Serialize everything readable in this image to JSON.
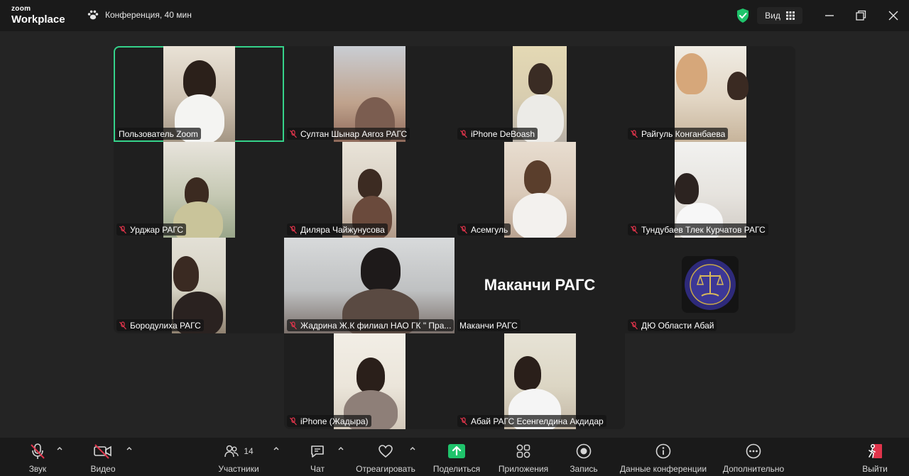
{
  "app": {
    "logo_top": "zoom",
    "logo_bottom": "Workplace",
    "meeting_title": "Конференция, 40 мин",
    "view_label": "Вид"
  },
  "participants": [
    {
      "name": "Пользователь Zoom",
      "muted": false,
      "active": true
    },
    {
      "name": "Султан Шынар Аягоз РАГС",
      "muted": true
    },
    {
      "name": "iPhone DeBoash",
      "muted": true
    },
    {
      "name": "Райгуль Конганбаева",
      "muted": true
    },
    {
      "name": "Урджар РАГС",
      "muted": true
    },
    {
      "name": "Диляра Чайжунусова",
      "muted": true
    },
    {
      "name": "Асемгуль",
      "muted": true
    },
    {
      "name": "Тундубаев Тлек Курчатов РАГС",
      "muted": true
    },
    {
      "name": "Бородулиха РАГС",
      "muted": true
    },
    {
      "name": "Жадрина Ж.К филиал НАО ГК \" Пра...",
      "muted": true
    },
    {
      "name": "Маканчи РАГС",
      "muted": false,
      "display_text": "Маканчи РАГС"
    },
    {
      "name": "ДЮ Области Абай",
      "muted": true
    },
    {
      "name": "iPhone (Жадыра)",
      "muted": true
    },
    {
      "name": "Абай РАГС Есенгелдина Акдидар",
      "muted": true
    }
  ],
  "toolbar": {
    "audio": "Звук",
    "video": "Видео",
    "participants": "Участники",
    "participants_count": "14",
    "chat": "Чат",
    "react": "Отреагировать",
    "share": "Поделиться",
    "apps": "Приложения",
    "record": "Запись",
    "info": "Данные конференции",
    "more": "Дополнительно",
    "leave": "Выйти"
  },
  "colors": {
    "active_speaker": "#35d28a",
    "share_green": "#1fc36b",
    "muted_red": "#e0344b",
    "background": "#242424"
  }
}
